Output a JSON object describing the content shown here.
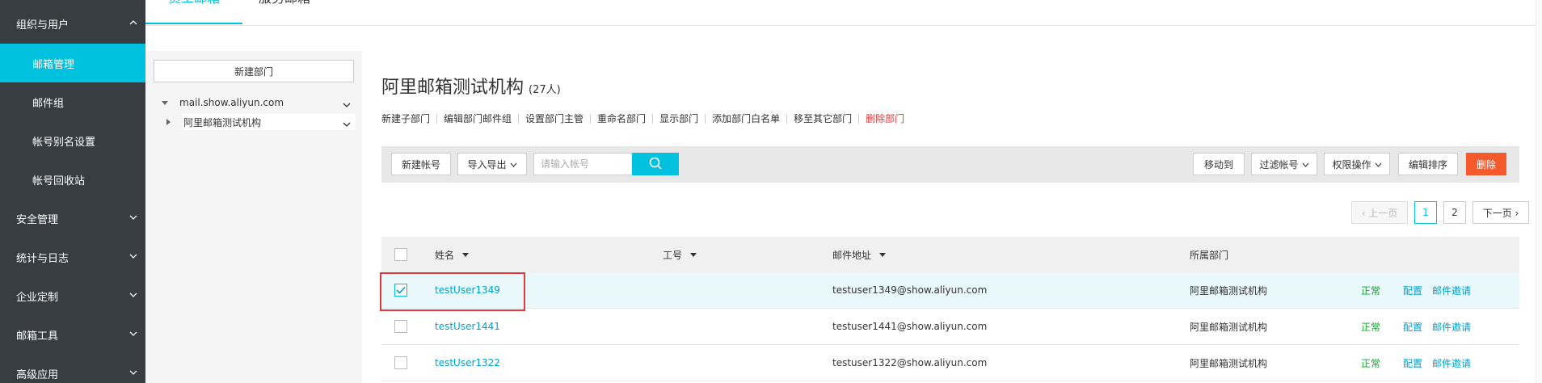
{
  "sidebar": {
    "items": [
      {
        "label": "组织与用户",
        "type": "group",
        "expanded": true
      },
      {
        "label": "邮箱管理",
        "type": "sub",
        "active": true
      },
      {
        "label": "邮件组",
        "type": "sub"
      },
      {
        "label": "帐号别名设置",
        "type": "sub"
      },
      {
        "label": "帐号回收站",
        "type": "sub"
      },
      {
        "label": "安全管理",
        "type": "group"
      },
      {
        "label": "统计与日志",
        "type": "group"
      },
      {
        "label": "企业定制",
        "type": "group"
      },
      {
        "label": "邮箱工具",
        "type": "group"
      },
      {
        "label": "高级应用",
        "type": "group"
      }
    ]
  },
  "tabs": [
    {
      "label": "员工邮箱",
      "active": true
    },
    {
      "label": "服务邮箱"
    }
  ],
  "dept_panel": {
    "new_dept_label": "新建部门",
    "root": "mail.show.aliyun.com",
    "child": "阿里邮箱测试机构"
  },
  "main": {
    "org_title": "阿里邮箱测试机构",
    "org_count": "(27人)",
    "actions": [
      "新建子部门",
      "编辑部门邮件组",
      "设置部门主管",
      "重命名部门",
      "显示部门",
      "添加部门白名单",
      "移至其它部门"
    ],
    "delete_dept": "删除部门",
    "toolbar": {
      "new_account": "新建帐号",
      "import_export": "导入导出",
      "search_placeholder": "请输入帐号",
      "move_to": "移动到",
      "filter_account": "过滤帐号",
      "permission": "权限操作",
      "edit_sort": "编辑排序",
      "delete": "删除"
    },
    "pager": {
      "prev": "‹ 上一页",
      "pages": [
        "1",
        "2"
      ],
      "current": "1",
      "next": "下一页 ›"
    },
    "table": {
      "headers": {
        "name": "姓名",
        "job_no": "工号",
        "email": "邮件地址",
        "dept": "所属部门"
      },
      "rows": [
        {
          "name": "testUser1349",
          "email": "testuser1349@show.aliyun.com",
          "dept": "阿里邮箱测试机构",
          "status": "正常",
          "config": "配置",
          "invite": "邮件邀请",
          "checked": true
        },
        {
          "name": "testUser1441",
          "email": "testuser1441@show.aliyun.com",
          "dept": "阿里邮箱测试机构",
          "status": "正常",
          "config": "配置",
          "invite": "邮件邀请",
          "checked": false
        },
        {
          "name": "testUser1322",
          "email": "testuser1322@show.aliyun.com",
          "dept": "阿里邮箱测试机构",
          "status": "正常",
          "config": "配置",
          "invite": "邮件邀请",
          "checked": false
        }
      ]
    }
  },
  "colors": {
    "accent": "#00c1de",
    "sidebar_bg": "#373d41",
    "danger": "#f55a2d",
    "ok": "#1aa034"
  }
}
